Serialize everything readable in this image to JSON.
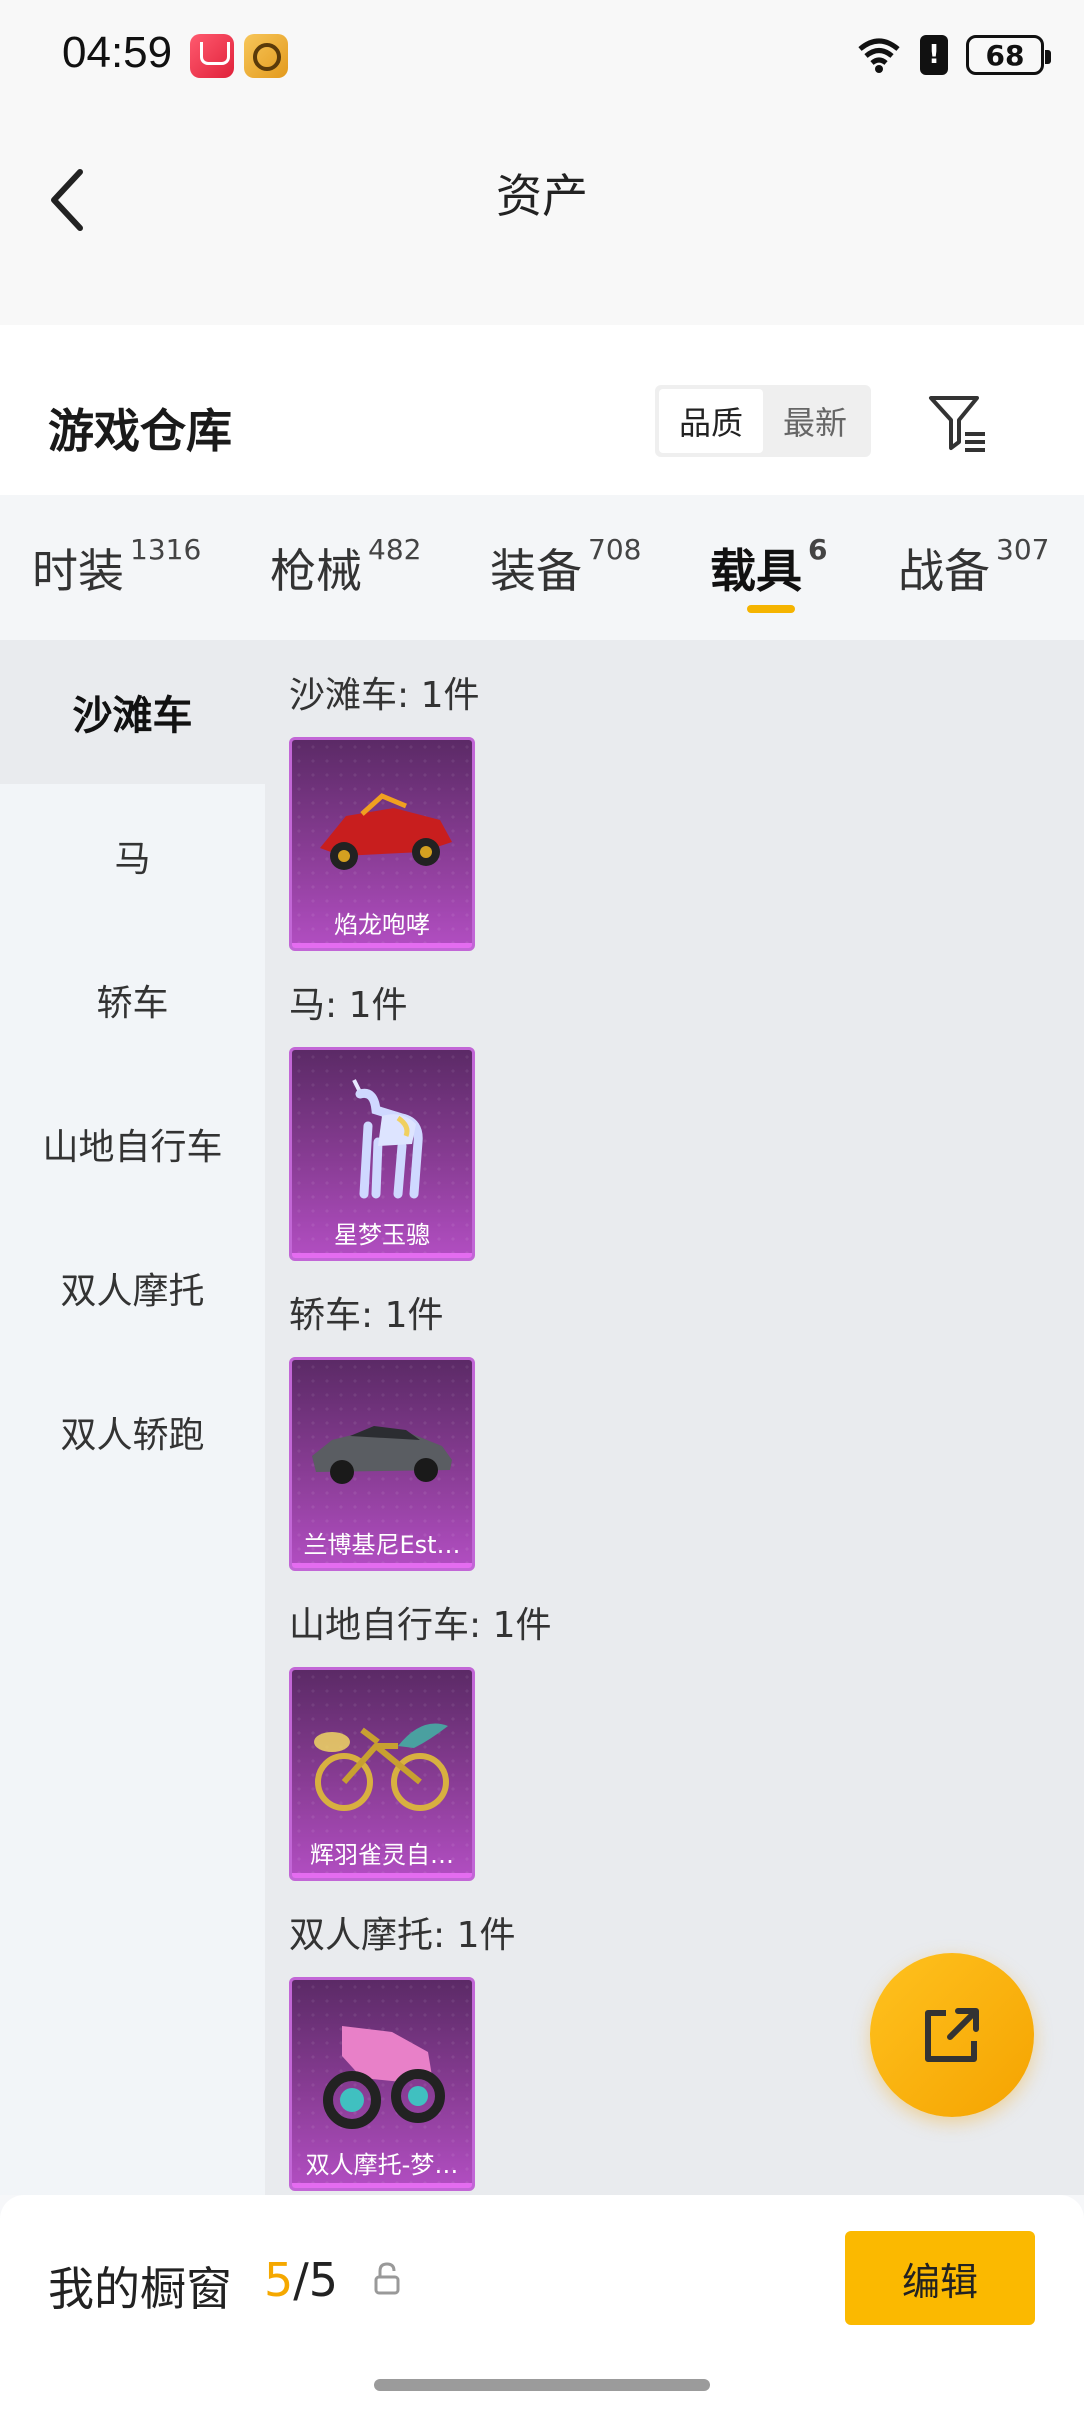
{
  "status_bar": {
    "time": "04:59",
    "battery": "68"
  },
  "header": {
    "title": "资产"
  },
  "warehouse": {
    "title": "游戏仓库",
    "sort_options": [
      "品质",
      "最新"
    ],
    "active_sort": "品质"
  },
  "tabs": [
    {
      "label": "时装",
      "count": "1316"
    },
    {
      "label": "枪械",
      "count": "482"
    },
    {
      "label": "装备",
      "count": "708"
    },
    {
      "label": "载具",
      "count": "6",
      "active": true
    },
    {
      "label": "战备",
      "count": "307"
    }
  ],
  "sidebar": {
    "items": [
      "沙滩车",
      "马",
      "轿车",
      "山地自行车",
      "双人摩托",
      "双人轿跑"
    ],
    "active": "沙滩车"
  },
  "groups": [
    {
      "label": "沙滩车: 1件",
      "item_name": "焰龙咆哮",
      "icon": "red-buggy-icon"
    },
    {
      "label": "马: 1件",
      "item_name": "星梦玉骢",
      "icon": "crystal-unicorn-icon"
    },
    {
      "label": "轿车: 1件",
      "item_name": "兰博基尼Est…",
      "icon": "grey-sports-car-icon"
    },
    {
      "label": "山地自行车: 1件",
      "item_name": "辉羽雀灵自…",
      "icon": "golden-bike-icon"
    },
    {
      "label": "双人摩托: 1件",
      "item_name": "双人摩托-梦…",
      "icon": "pink-motorcycle-icon"
    }
  ],
  "bottom_bar": {
    "showcase_label": "我的橱窗",
    "showcase_current": "5",
    "showcase_total": "/5",
    "edit_label": "编辑"
  }
}
